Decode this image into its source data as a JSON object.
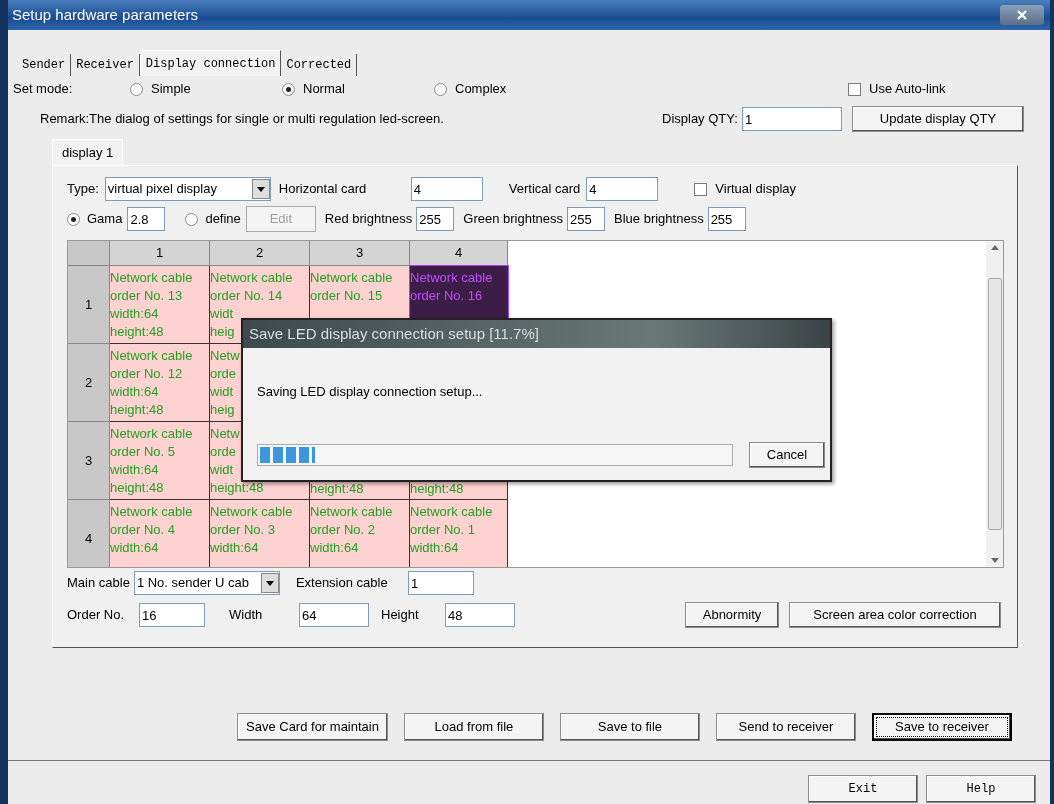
{
  "window": {
    "title": "Setup hardware parameters"
  },
  "tabs": [
    {
      "label": "Sender",
      "selected": false
    },
    {
      "label": "Receiver",
      "selected": false
    },
    {
      "label": "Display connection",
      "selected": true
    },
    {
      "label": "Corrected",
      "selected": false
    }
  ],
  "set_mode": {
    "label": "Set mode:",
    "options": [
      {
        "label": "Simple",
        "selected": false
      },
      {
        "label": "Normal",
        "selected": true
      },
      {
        "label": "Complex",
        "selected": false
      }
    ]
  },
  "auto_link": {
    "label": "Use Auto-link",
    "checked": false
  },
  "remark": "Remark:The dialog of settings for single or multi  regulation led-screen.",
  "display_qty": {
    "label": "Display QTY:",
    "value": "1"
  },
  "update_button": "Update display QTY",
  "display_tabs": [
    {
      "label": "display 1",
      "selected": true
    }
  ],
  "type": {
    "label": "Type:",
    "value": "virtual pixel display"
  },
  "horizontal_card": {
    "label": "Horizontal card",
    "value": "4"
  },
  "vertical_card": {
    "label": "Vertical card",
    "value": "4"
  },
  "virtual_display": {
    "label": "Virtual display",
    "checked": false
  },
  "gamma_options": [
    {
      "label": "Gama",
      "selected": true,
      "value": "2.8"
    },
    {
      "label": "define",
      "selected": false
    }
  ],
  "edit_button": {
    "label": "Edit",
    "disabled": true
  },
  "brightness": [
    {
      "label": "Red brightness",
      "value": "255"
    },
    {
      "label": "Green brightness",
      "value": "255"
    },
    {
      "label": "Blue brightness",
      "value": "255"
    }
  ],
  "grid": {
    "columns": [
      "1",
      "2",
      "3",
      "4"
    ],
    "rows": [
      {
        "header": "1",
        "cells": [
          {
            "lines": [
              "Network cable",
              "order No. 13",
              "width:64",
              "height:48"
            ],
            "selected": false
          },
          {
            "lines": [
              "Network cable",
              "order No. 14",
              "widt",
              "heig"
            ],
            "selected": false
          },
          {
            "lines": [
              "Network cable",
              "order No. 15"
            ],
            "selected": false
          },
          {
            "lines": [
              "Network cable",
              "order No. 16"
            ],
            "selected": true
          }
        ]
      },
      {
        "header": "2",
        "cells": [
          {
            "lines": [
              "Network cable",
              "order No. 12",
              "width:64",
              "height:48"
            ],
            "selected": false
          },
          {
            "lines": [
              "Netw",
              "orde",
              "widt",
              "heig"
            ],
            "selected": false
          }
        ]
      },
      {
        "header": "3",
        "cells": [
          {
            "lines": [
              "Network cable",
              "order No. 5",
              "width:64",
              "height:48"
            ],
            "selected": false
          },
          {
            "lines": [
              "Netw",
              "orde",
              "widt",
              "height:48"
            ],
            "selected": false
          },
          {
            "lines": [
              "height:48"
            ],
            "covered_top": true,
            "selected": false
          },
          {
            "lines": [
              "height:48"
            ],
            "covered_top": true,
            "selected": false
          }
        ]
      },
      {
        "header": "4",
        "cells": [
          {
            "lines": [
              "Network cable",
              "order No. 4",
              "width:64"
            ],
            "selected": false
          },
          {
            "lines": [
              "Network cable",
              "order No. 3",
              "width:64"
            ],
            "selected": false
          },
          {
            "lines": [
              "Network cable",
              "order No. 2",
              "width:64"
            ],
            "selected": false
          },
          {
            "lines": [
              "Network cable",
              "order No. 1",
              "width:64"
            ],
            "selected": false
          }
        ]
      }
    ]
  },
  "main_cable": {
    "label": "Main cable",
    "value": "1 No. sender U cab"
  },
  "extension_cable": {
    "label": "Extension cable",
    "value": "1"
  },
  "order_no": {
    "label": "Order No.",
    "value": "16"
  },
  "width": {
    "label": "Width",
    "value": "64"
  },
  "height": {
    "label": "Height",
    "value": "48"
  },
  "abnormity_button": "Abnormity",
  "color_correction_button": "Screen area color correction",
  "bottom_buttons": [
    {
      "label": "Save Card for maintain",
      "focused": false
    },
    {
      "label": "Load from file",
      "focused": false
    },
    {
      "label": "Save to file",
      "focused": false
    },
    {
      "label": "Send to receiver",
      "focused": false
    },
    {
      "label": "Save to receiver",
      "focused": true
    }
  ],
  "footer_buttons": [
    "Exit",
    "Help"
  ],
  "dialog": {
    "title": "Save LED display connection setup [11.7%]",
    "message": "Saving LED display connection setup...",
    "progress": {
      "level": 0.117
    },
    "cancel": "Cancel"
  }
}
